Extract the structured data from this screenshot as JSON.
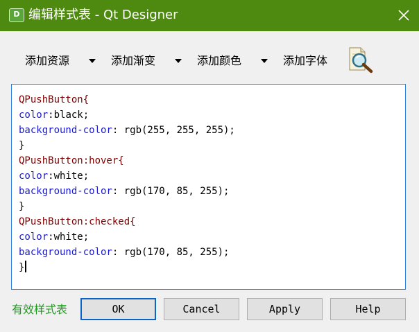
{
  "window": {
    "title": "编辑样式表 - Qt Designer",
    "app_icon_letter": "D",
    "close_icon": "close-icon"
  },
  "toolbar": {
    "items": [
      {
        "label": "添加资源",
        "has_dropdown": true
      },
      {
        "label": "添加渐变",
        "has_dropdown": true
      },
      {
        "label": "添加颜色",
        "has_dropdown": true
      },
      {
        "label": "添加字体",
        "has_dropdown": false
      }
    ],
    "font_icon": "font-find-icon"
  },
  "editor": {
    "lines": [
      {
        "selector": "QPushButton{"
      },
      {
        "prop": "color",
        "value": ":black;"
      },
      {
        "prop": "background-color",
        "value": ": rgb(255, 255, 255);"
      },
      {
        "plain": "}"
      },
      {
        "selector": "QPushButton:hover{"
      },
      {
        "prop": "color",
        "value": ":white;"
      },
      {
        "prop": "background-color",
        "value": ": rgb(170, 85, 255);"
      },
      {
        "plain": "}"
      },
      {
        "selector": "QPushButton:checked{"
      },
      {
        "prop": "color",
        "value": ":white;"
      },
      {
        "prop": "background-color",
        "value": ": rgb(170, 85, 255);"
      },
      {
        "plain": "}"
      }
    ]
  },
  "footer": {
    "status": "有效样式表",
    "ok": "OK",
    "cancel": "Cancel",
    "apply": "Apply",
    "help": "Help"
  },
  "colors": {
    "titlebar": "#4f8a10",
    "selector": "#800000",
    "property": "#1a1ad0",
    "status_valid": "#1d9a1d",
    "focus_border": "#0a64c8"
  }
}
